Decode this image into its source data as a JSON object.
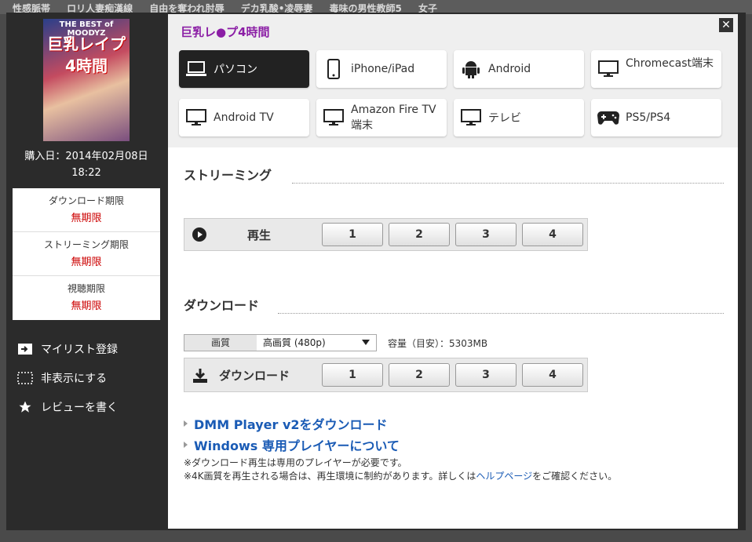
{
  "background": {
    "strip": [
      "性感脈帯",
      "ロリ人妻痴漢線",
      "自由を奪われ肘辱",
      "デカ乳酸•凌辱妻",
      "毒味の男性教師5",
      "女子"
    ]
  },
  "product": {
    "cover_line1": "THE BEST of MOODYZ",
    "cover_line2": "巨乳レイプ",
    "cover_line3": "4時間",
    "title": "巨乳レ●プ4時間",
    "purchase_line1": "購入日：2014年02月08日",
    "purchase_line2": "18:22"
  },
  "limits": [
    {
      "label": "ダウンロード期限",
      "value": "無期限"
    },
    {
      "label": "ストリーミング期限",
      "value": "無期限"
    },
    {
      "label": "視聴期限",
      "value": "無期限"
    }
  ],
  "actions": {
    "mylist": "マイリスト登録",
    "hide": "非表示にする",
    "review": "レビューを書く"
  },
  "close_label": "✕",
  "devices": [
    {
      "label": "パソコン",
      "icon": "laptop-icon",
      "active": true
    },
    {
      "label": "iPhone/iPad",
      "icon": "phone-icon",
      "active": false
    },
    {
      "label": "Android",
      "icon": "android-icon",
      "active": false
    },
    {
      "label": "Chromecast端末",
      "icon": "monitor-icon",
      "active": false
    },
    {
      "label": "Android TV",
      "icon": "monitor-icon",
      "active": false
    },
    {
      "label": "Amazon Fire TV",
      "label2": "端末",
      "icon": "monitor-icon",
      "active": false
    },
    {
      "label": "テレビ",
      "icon": "monitor-icon",
      "active": false
    },
    {
      "label": "PS5/PS4",
      "icon": "gamepad-icon",
      "active": false
    }
  ],
  "streaming": {
    "heading": "ストリーミング",
    "play_label": "再生",
    "parts": [
      "1",
      "2",
      "3",
      "4"
    ]
  },
  "download": {
    "heading": "ダウンロード",
    "quality_label": "画質",
    "quality_value": "高画質 (480p)",
    "capacity": "容量（目安）：5303MB",
    "button_label": "ダウンロード",
    "parts": [
      "1",
      "2",
      "3",
      "4"
    ]
  },
  "links": {
    "player": "DMM Player v2をダウンロード",
    "windows": "Windows 専用プレイヤーについて"
  },
  "notes": {
    "note1": "※ダウンロード再生は専用のプレイヤーが必要です。",
    "note2_pre": "※4K画質を再生される場合は、再生環境に制約があります。詳しくは",
    "note2_link": "ヘルプページ",
    "note2_post": "をご確認ください。"
  },
  "colors": {
    "title": "#8b1ea5",
    "link": "#1a5bb5",
    "limit_value": "#cc0000"
  }
}
